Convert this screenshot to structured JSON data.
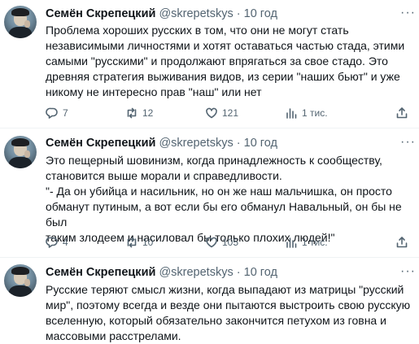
{
  "tweets": [
    {
      "name": "Семён Скрепецкий",
      "handle": "@skrepetskys",
      "dot": "·",
      "time": "10 год",
      "text": "Проблема хороших русских в том, что они не могут стать\nнезависимыми личностями и хотят оставаться частью стада, этими\nсамыми \"русскими\" и продолжают впрягаться за свое стадо. Это\nдревняя стратегия выживания видов, из серии \"наших бьют\" и уже\nникому не интересно прав \"наш\" или нет",
      "replies": "7",
      "retweets": "12",
      "likes": "121",
      "views": "1 тис."
    },
    {
      "name": "Семён Скрепецкий",
      "handle": "@skrepetskys",
      "dot": "·",
      "time": "10 год",
      "text": "Это пещерный шовинизм, когда принадлежность к сообществу,\nстановится выше морали и справедливости.\n\"- Да он убийца и насильник, но он же наш мальчишка, он просто\nобманут путиным, а вот если бы его обманул Навальный, он бы не был\nтаким злодеем и насиловал бы только плохих людей!\"",
      "replies": "4",
      "retweets": "10",
      "likes": "105",
      "views": "1 тис."
    },
    {
      "name": "Семён Скрепецкий",
      "handle": "@skrepetskys",
      "dot": "·",
      "time": "10 год",
      "text": "Русские теряют смысл жизни, когда выпадают из матрицы \"русский\nмир\", поэтому всегда и везде они пытаются выстроить свою русскую\nвселенную, который обязательно закончится петухом из говна и\nмассовыми расстрелами."
    }
  ]
}
